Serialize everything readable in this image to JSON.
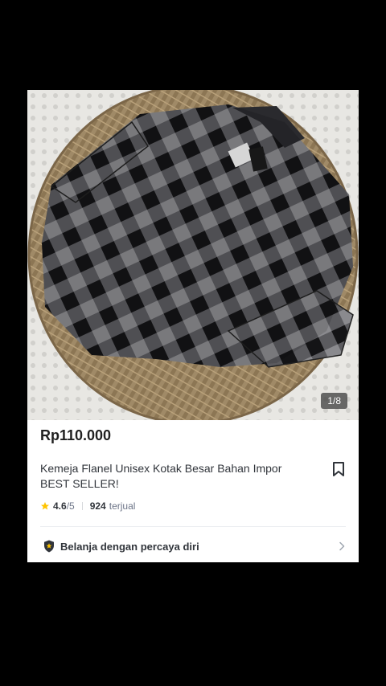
{
  "product": {
    "image_counter": "1/8",
    "price": "Rp110.000",
    "title": "Kemeja Flanel Unisex Kotak Besar Bahan Impor BEST SELLER!",
    "rating": "4.6",
    "rating_max": "/5",
    "sold_count": "924",
    "sold_label": "terjual",
    "trust_label": "Belanja dengan percaya diri"
  },
  "icons": {
    "bookmark": "bookmark-icon",
    "star": "star-icon",
    "shield": "shield-icon",
    "chevron": "chevron-right-icon"
  },
  "colors": {
    "star": "#ffc400",
    "text": "#31353b",
    "muted": "#6d7588"
  }
}
